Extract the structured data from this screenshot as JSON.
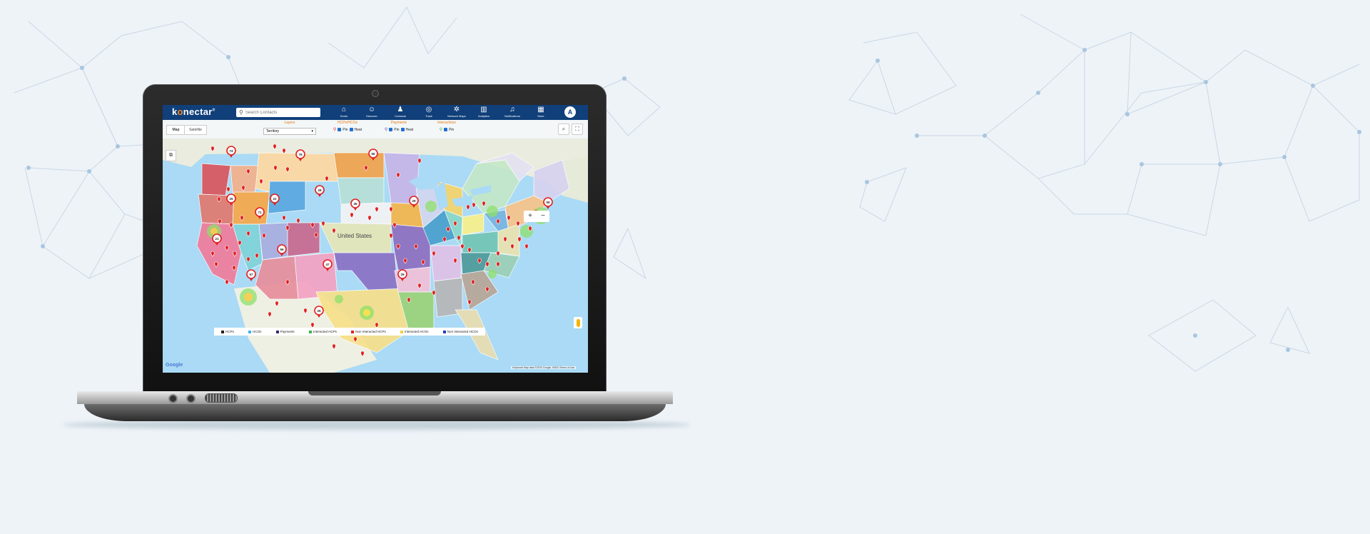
{
  "app": {
    "logo_text_pre": "k",
    "logo_text_o": "o",
    "logo_text_post": "nectar",
    "logo_mark": "®"
  },
  "search": {
    "placeholder": "Search Contacts"
  },
  "nav": [
    {
      "label": "Home",
      "icon": "home-icon"
    },
    {
      "label": "Discover",
      "icon": "discover-icon"
    },
    {
      "label": "Contacts",
      "icon": "contacts-icon"
    },
    {
      "label": "Track",
      "icon": "track-icon"
    },
    {
      "label": "Network Maps",
      "icon": "network-icon"
    },
    {
      "label": "Analytics",
      "icon": "analytics-icon"
    },
    {
      "label": "Notifications",
      "icon": "bell-icon"
    },
    {
      "label": "More",
      "icon": "grid-icon"
    }
  ],
  "user": {
    "avatar_initial": "A"
  },
  "map_tabs": {
    "map": "Map",
    "satellite": "Satellite"
  },
  "filters": {
    "layers": {
      "label": "Layers",
      "selected": "Territory"
    },
    "hcps_hcos": {
      "label": "HCPs/HCOs",
      "pin": "Pin",
      "heat": "Heat"
    },
    "payments": {
      "label": "Payments",
      "pin": "Pin",
      "heat": "Heat"
    },
    "interactions": {
      "label": "Interactions",
      "pin": "Pin"
    }
  },
  "map": {
    "country_label": "United States",
    "zoom_in": "+",
    "zoom_out": "−",
    "google": "Google",
    "terms": "Keyboard   Map data ©2020 Google, INEGI   Terms of Use"
  },
  "clusters": [
    "74",
    "76",
    "56",
    "25",
    "22",
    "28",
    "45",
    "71",
    "29",
    "21",
    "56",
    "47",
    "57",
    "29",
    "68",
    "59",
    "25"
  ],
  "legend": [
    {
      "label": "HCPs",
      "color": "#222222"
    },
    {
      "label": "HCOs",
      "color": "#3fb0e6"
    },
    {
      "label": "Payments",
      "color": "#3a2a6d"
    },
    {
      "label": "Interacted HCPs",
      "color": "#3cb54a"
    },
    {
      "label": "Non Interacted HCPs",
      "color": "#e02020"
    },
    {
      "label": "Interacted HCOs",
      "color": "#f4d03f"
    },
    {
      "label": "Non Interacted HCOs",
      "color": "#1f3fbf"
    }
  ]
}
